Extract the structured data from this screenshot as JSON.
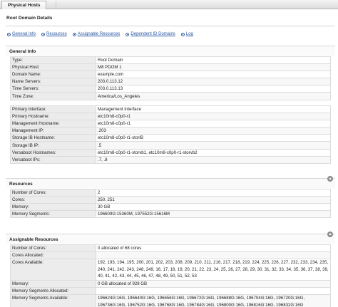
{
  "window": {
    "tab_label": "Physical Hosts"
  },
  "page": {
    "title": "Root Domain Details"
  },
  "nav": [
    {
      "label": "General Info"
    },
    {
      "label": "Resources"
    },
    {
      "label": "Assignable Resources"
    },
    {
      "label": "Dependent ID Domains"
    },
    {
      "label": "Log"
    }
  ],
  "general_info": {
    "title": "General Info",
    "group1": [
      {
        "key": "Type:",
        "value": "Root Domain"
      },
      {
        "key": "Physical Host:",
        "value": "M8 PDOM 1"
      },
      {
        "key": "Domain Name:",
        "value": "example.com"
      },
      {
        "key": "Name Servers:",
        "value": "203.0.113.12"
      },
      {
        "key": "Time Servers:",
        "value": "203.0.113.13"
      },
      {
        "key": "Time Zone:",
        "value": "America/Los_Angeles"
      }
    ],
    "group2": [
      {
        "key": "Primary Interface:",
        "value": "Management Interface"
      },
      {
        "key": "Primary Hostname:",
        "value": "etc10m8-c0p0-r1"
      },
      {
        "key": "Management Hostname:",
        "value": "etc10m8-c0p0-r1"
      },
      {
        "key": "Management IP:",
        "value": ".203"
      },
      {
        "key": "Storage IB Hostname:",
        "value": "etc10m8-c0p0-r1-storIB"
      },
      {
        "key": "Storage IB IP:",
        "value": ".5"
      },
      {
        "key": "Versaboot Hostnames:",
        "value": "etc10m8-c0p0-r1-storvb1, etc10m8-c0p0-r1-storvb2"
      },
      {
        "key": "Versaboot IPs:",
        "value": ".7,          .8"
      }
    ]
  },
  "resources": {
    "title": "Resources",
    "rows": [
      {
        "key": "Number of Cores:",
        "value": "2"
      },
      {
        "key": "Cores:",
        "value": "250, 251"
      },
      {
        "key": "Memory:",
        "value": "30 GB"
      },
      {
        "key": "Memory Segments:",
        "value": "196609G:15360M, 197552G:15616M"
      }
    ]
  },
  "assignable": {
    "title": "Assignable Resources",
    "rows": [
      {
        "key": "Number of Cores:",
        "value": "0 allocated of 68 cores"
      },
      {
        "key": "Cores Allocated:",
        "value": ""
      },
      {
        "key": "Cores Available:",
        "value": "192, 193, 194, 195, 200, 201, 202, 203, 208, 209, 210, 211, 216, 217, 218, 219, 224, 225, 226, 227, 232, 233, 234, 235, 240, 241, 242, 243, 248, 249, 16, 17, 18, 19, 20, 21, 22, 23, 24, 25, 26, 27, 28, 29, 30, 31, 32, 33, 34, 35, 36, 37, 38, 39, 40, 41, 42, 43, 44, 45, 46, 47, 48, 49, 50, 51, 52, 53"
      },
      {
        "key": "Memory:",
        "value": "0 GB allocated of 928 GB"
      },
      {
        "key": "Memory Segments Allocated:",
        "value": ""
      },
      {
        "key": "Memory Segments Available:",
        "value": "196624G:16G, 196640G:16G, 196656G:16G, 196672G:16G, 196688G:16G, 196704G:16G, 196720G:16G, 196736G:16G, 196752G:16G, 196768G:16G, 196784G:16G, 196800G:16G, 196816G:16G, 196832G:16G"
      }
    ]
  }
}
